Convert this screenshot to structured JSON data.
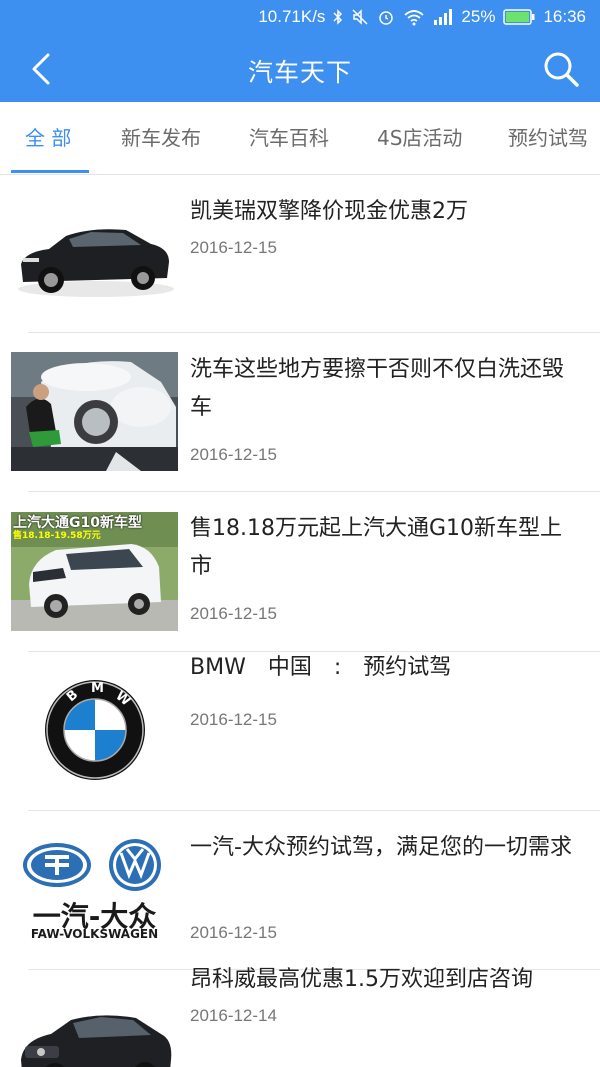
{
  "status": {
    "speed": "10.71K/s",
    "battery": "25%",
    "time": "16:36"
  },
  "appbar": {
    "title": "汽车天下"
  },
  "tabs": [
    {
      "label": "全 部"
    },
    {
      "label": "新车发布"
    },
    {
      "label": "汽车百科"
    },
    {
      "label": "4S店活动"
    },
    {
      "label": "预约试驾"
    }
  ],
  "articles": [
    {
      "title": "凯美瑞双擎降价现金优惠2万",
      "date": "2016-12-15",
      "thumb": "black-sedan"
    },
    {
      "title": "洗车这些地方要擦干否则不仅白洗还毁车",
      "date": "2016-12-15",
      "thumb": "car-wash"
    },
    {
      "title": "售18.18万元起上汽大通G10新车型上市",
      "date": "2016-12-15",
      "thumb": "white-mpv",
      "banner": "上汽大通G10新车型",
      "banner_sub": "售18.18-19.58万元"
    },
    {
      "title": "BMW　中国　:　预约试驾",
      "date": "2016-12-15",
      "thumb": "bmw-logo"
    },
    {
      "title": "一汽-大众预约试驾，满足您的一切需求",
      "date": "2016-12-15",
      "thumb": "faw-vw-logo",
      "logo_cn": "一汽-大众",
      "logo_en": "FAW-VOLKSWAGEN"
    },
    {
      "title": "昂科威最高优惠1.5万欢迎到店咨询",
      "date": "2016-12-14",
      "thumb": "black-suv"
    }
  ],
  "colors": {
    "primary": "#3d8ff0"
  }
}
